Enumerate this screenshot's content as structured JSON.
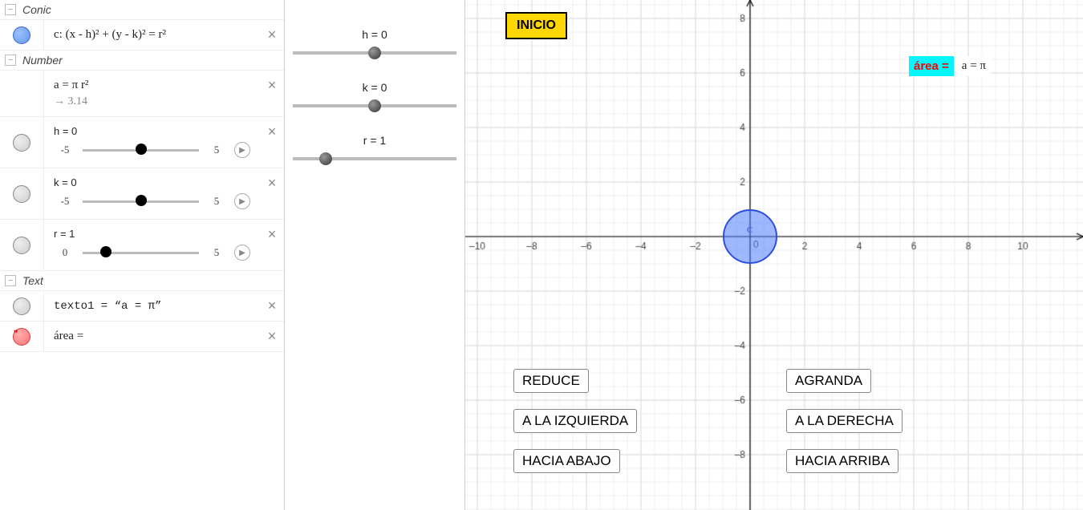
{
  "sections": {
    "conic": "Conic",
    "number": "Number",
    "text_sect": "Text"
  },
  "conic": {
    "formula": "c: (x - h)² + (y - k)² = r²"
  },
  "numbers": {
    "a_def": "a = π r²",
    "a_val": "→ 3.14",
    "h": {
      "label": "h = 0",
      "min": "-5",
      "max": "5",
      "value": 0
    },
    "k": {
      "label": "k = 0",
      "min": "-5",
      "max": "5",
      "value": 0
    },
    "r": {
      "label": "r = 1",
      "min": "0",
      "max": "5",
      "value": 1
    }
  },
  "texts": {
    "t1": "texto1 = “a = π”",
    "t2": "área ="
  },
  "midsliders": {
    "h": {
      "label": "h = 0",
      "pct": 50
    },
    "k": {
      "label": "k = 0",
      "pct": 50
    },
    "r": {
      "label": "r = 1",
      "pct": 20
    }
  },
  "buttons": {
    "inicio": "INICIO",
    "reduce": "REDUCE",
    "agranda": "AGRANDA",
    "izq": "A LA IZQUIERDA",
    "der": "A LA DERECHA",
    "abajo": "HACIA ABAJO",
    "arriba": "HACIA ARRIBA"
  },
  "area": {
    "label": "área = ",
    "value": "a = π"
  },
  "circle": {
    "label": "C",
    "h": 0,
    "k": 0,
    "r": 1
  },
  "axes": {
    "xmin": -10,
    "xmax": 10,
    "xmajor": 2,
    "ymax": 8,
    "ymin": -8,
    "ymajor": 2
  },
  "axis_labels": {
    "x": [
      "–10",
      "–8",
      "–6",
      "–4",
      "–2",
      "0",
      "2",
      "4",
      "6",
      "8",
      "10"
    ],
    "y": [
      "8",
      "6",
      "4",
      "2",
      "–2",
      "–4",
      "–6",
      "–8"
    ]
  }
}
